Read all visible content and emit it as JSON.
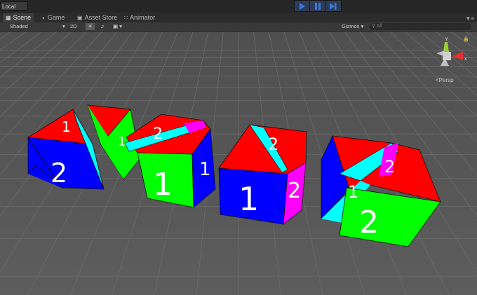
{
  "toolbar": {
    "pivot_mode": "Local",
    "playback": {
      "play_icon": "play-icon",
      "pause_icon": "pause-icon",
      "step_icon": "step-icon"
    }
  },
  "tabs": [
    {
      "label": "Scene",
      "icon": "scene-icon",
      "active": true
    },
    {
      "label": "Game",
      "icon": "game-icon",
      "active": false
    },
    {
      "label": "Asset Store",
      "icon": "asset-store-icon",
      "active": false
    },
    {
      "label": "Animator",
      "icon": "animator-icon",
      "active": false
    }
  ],
  "scene_toolbar": {
    "draw_mode": "Shaded",
    "mode_2d": "2D",
    "gizmos": "Gizmos",
    "search_placeholder": "All"
  },
  "gizmo": {
    "y_label": "y",
    "x_label": "x",
    "projection": "Persp"
  },
  "cubes": [
    {
      "front_number": "2",
      "top_number": "1",
      "colors": {
        "top": "#ff0000",
        "left": "#0000ff",
        "right": "#00ffff"
      }
    },
    {
      "side_number": "1",
      "colors": {
        "top": "#ff0000",
        "side": "#00ff00"
      }
    },
    {
      "front_number": "1",
      "top_number": "2",
      "side_number": "1",
      "colors": {
        "top": "#ff0000",
        "front": "#00ff00",
        "side": "#0000ff",
        "strip": "#00ffff",
        "accent": "#ff00ff"
      }
    },
    {
      "front_number": "1",
      "top_number": "2",
      "side_number": "2",
      "colors": {
        "top": "#ff0000",
        "front": "#0000ff",
        "side": "#ff00ff",
        "strip": "#00ffff"
      }
    },
    {
      "front_number": "2",
      "top_number": "2",
      "side_number": "1",
      "colors": {
        "top": "#ff0000",
        "front": "#00ff00",
        "left": "#0000ff",
        "side": "#00ffff",
        "accent": "#ff00ff"
      }
    }
  ],
  "colors": {
    "background": "#5a5a5a",
    "grid": "#6a6a6a",
    "play_active": "#3c78d8"
  }
}
